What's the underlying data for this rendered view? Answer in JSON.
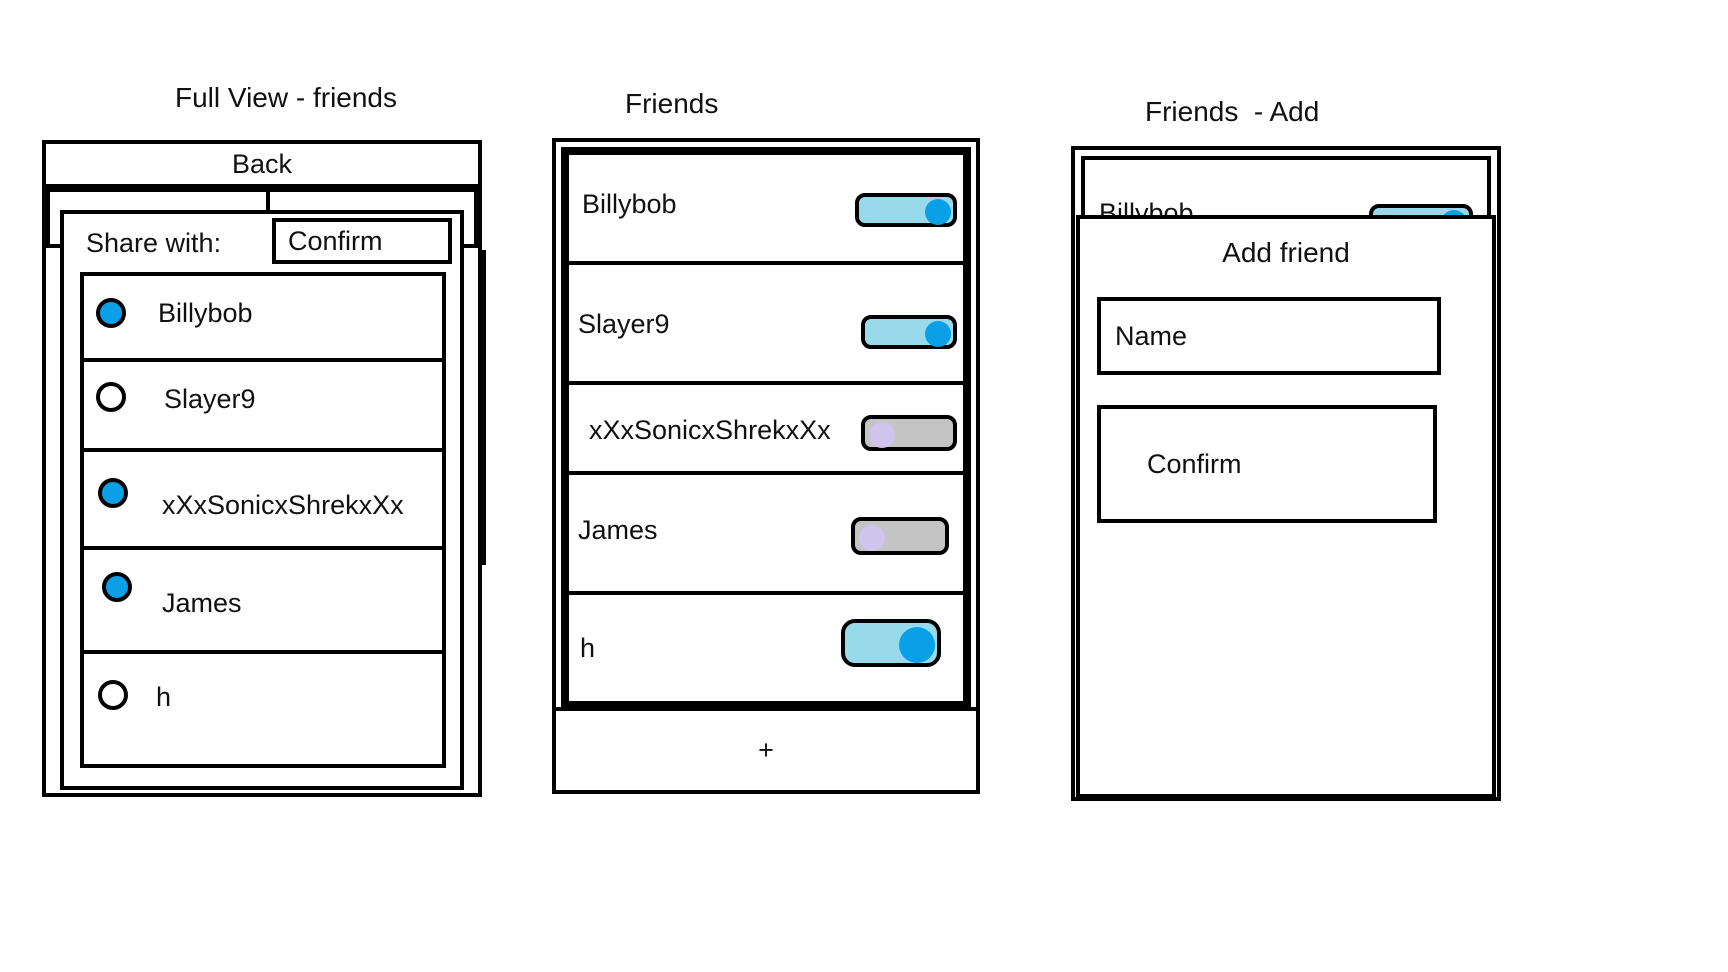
{
  "screens": {
    "full_view": {
      "title": "Full View - friends",
      "back_label": "Back",
      "share_label": "Share with:",
      "confirm_label": "Confirm",
      "friends": [
        {
          "name": "Billybob",
          "selected": true
        },
        {
          "name": "Slayer9",
          "selected": false
        },
        {
          "name": "xXxSonicxShrekxXx",
          "selected": true
        },
        {
          "name": "James",
          "selected": true
        },
        {
          "name": "h",
          "selected": false
        }
      ]
    },
    "friends": {
      "title": "Friends",
      "add_label": "+",
      "friends": [
        {
          "name": "Billybob",
          "enabled": true
        },
        {
          "name": "Slayer9",
          "enabled": true
        },
        {
          "name": "xXxSonicxShrekxXx",
          "enabled": false
        },
        {
          "name": "James",
          "enabled": false
        },
        {
          "name": "h",
          "enabled": true
        }
      ]
    },
    "friends_add": {
      "title": "Friends  - Add",
      "behind_item": "Billybob",
      "dialog_title": "Add friend",
      "name_placeholder": "Name",
      "confirm_label": "Confirm"
    }
  },
  "colors": {
    "radio_on": "#0aa0e8",
    "toggle_on_track": "#98d9ec",
    "toggle_off_track": "#c4c4c4",
    "toggle_on_knob": "#0aa0e8",
    "toggle_off_knob": "#cfc4ec"
  }
}
